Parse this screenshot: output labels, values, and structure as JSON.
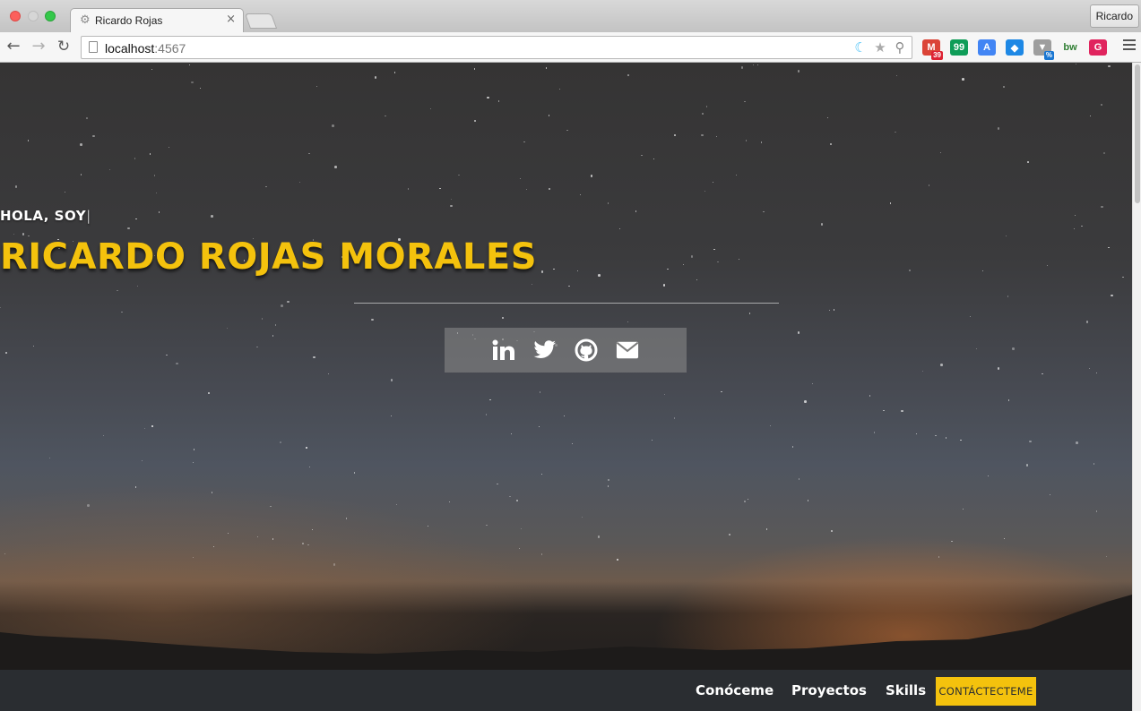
{
  "browser": {
    "tab_title": "Ricardo Rojas",
    "tab_close": "×",
    "profile_name": "Ricardo",
    "url_host": "localhost",
    "url_port": ":4567",
    "extensions": [
      {
        "name": "gmail",
        "label": "M",
        "badge": "39",
        "color": "#db4437"
      },
      {
        "name": "hangouts",
        "label": "99",
        "badge": "",
        "color": "#0f9d58"
      },
      {
        "name": "translate",
        "label": "A",
        "badge": "",
        "color": "#4285f4"
      },
      {
        "name": "dropbox",
        "label": "◆",
        "badge": "",
        "color": "#1e88e5"
      },
      {
        "name": "honey",
        "label": "▼",
        "badge": "%",
        "color": "#9e9e9e"
      },
      {
        "name": "bw",
        "label": "bw",
        "badge": "",
        "color": "#ffffff"
      },
      {
        "name": "grammarly",
        "label": "G",
        "badge": "",
        "color": "#e0245e"
      }
    ]
  },
  "hero": {
    "greeting": "HOLA, SOY",
    "name": "RICARDO ROJAS MORALES",
    "social": [
      {
        "name": "linkedin-icon",
        "label": "LinkedIn"
      },
      {
        "name": "twitter-icon",
        "label": "Twitter"
      },
      {
        "name": "github-icon",
        "label": "GitHub"
      },
      {
        "name": "email-icon",
        "label": "Email"
      }
    ]
  },
  "nav": {
    "links": [
      "Conóceme",
      "Proyectos",
      "Skills"
    ],
    "cta": "CONTÁCTECTEME"
  }
}
